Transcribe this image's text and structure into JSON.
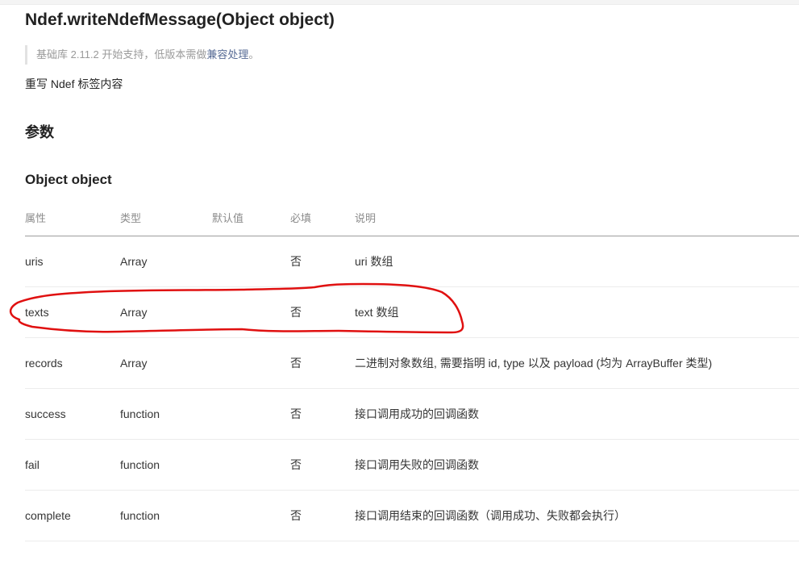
{
  "title": "Ndef.writeNdefMessage(Object object)",
  "note": {
    "prefix": "基础库 2.11.2 开始支持，低版本需做",
    "link": "兼容处理",
    "suffix": "。"
  },
  "description": "重写 Ndef 标签内容",
  "params_heading": "参数",
  "object_heading": "Object object",
  "table": {
    "headers": {
      "attr": "属性",
      "type": "类型",
      "default": "默认值",
      "required": "必填",
      "desc": "说明"
    },
    "rows": [
      {
        "attr": "uris",
        "type": "Array",
        "default": "",
        "required": "否",
        "desc": "uri 数组"
      },
      {
        "attr": "texts",
        "type": "Array",
        "default": "",
        "required": "否",
        "desc": "text 数组"
      },
      {
        "attr": "records",
        "type": "Array",
        "default": "",
        "required": "否",
        "desc": "二进制对象数组, 需要指明 id, type 以及 payload (均为 ArrayBuffer 类型)"
      },
      {
        "attr": "success",
        "type": "function",
        "default": "",
        "required": "否",
        "desc": "接口调用成功的回调函数"
      },
      {
        "attr": "fail",
        "type": "function",
        "default": "",
        "required": "否",
        "desc": "接口调用失败的回调函数"
      },
      {
        "attr": "complete",
        "type": "function",
        "default": "",
        "required": "否",
        "desc": "接口调用结束的回调函数（调用成功、失败都会执行）"
      }
    ]
  },
  "annotation_color": "#e01010"
}
